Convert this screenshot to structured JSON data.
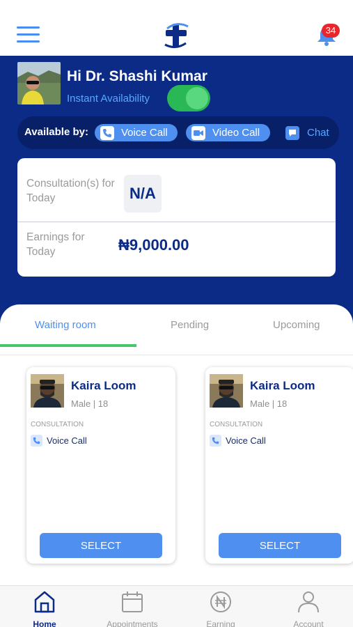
{
  "header": {
    "notification_count": "34"
  },
  "doctor": {
    "greeting": "Hi Dr. Shashi Kumar",
    "availability_label": "Instant Availability",
    "instant_availability_on": true
  },
  "available_by": {
    "title": "Available by:",
    "voice": "Voice Call",
    "video": "Video Call",
    "chat": "Chat"
  },
  "stats": {
    "consultations_label": "Consultation(s) for Today",
    "consultations_value": "N/A",
    "earnings_label": "Earnings for Today",
    "earnings_value": "₦9,000.00"
  },
  "tabs": [
    {
      "label": "Waiting room",
      "active": true
    },
    {
      "label": "Pending",
      "active": false
    },
    {
      "label": "Upcoming",
      "active": false
    }
  ],
  "patients": [
    {
      "name": "Kaira Loom",
      "meta": "Male | 18",
      "section": "CONSULTATION",
      "consult_type": "Voice Call",
      "button": "SELECT"
    },
    {
      "name": "Kaira Loom",
      "meta": "Male | 18",
      "section": "CONSULTATION",
      "consult_type": "Voice Call",
      "button": "SELECT"
    }
  ],
  "nav": {
    "home": "Home",
    "appointments": "Appointments",
    "earning": "Earning",
    "account": "Account"
  },
  "colors": {
    "primary_navy": "#0b2b86",
    "accent_blue": "#4e8ff0",
    "toggle_green": "#2ab756",
    "tab_indicator": "#43c86a",
    "badge_red": "#e8262c"
  },
  "icons": {
    "menu": "hamburger-icon",
    "logo": "medical-cross-logo",
    "notifications": "bell-icon",
    "voice": "phone-icon",
    "video": "video-camera-icon",
    "chat": "chat-bubble-icon",
    "home": "home-icon",
    "appointments": "calendar-icon",
    "earning": "naira-coin-icon",
    "account": "person-icon"
  }
}
